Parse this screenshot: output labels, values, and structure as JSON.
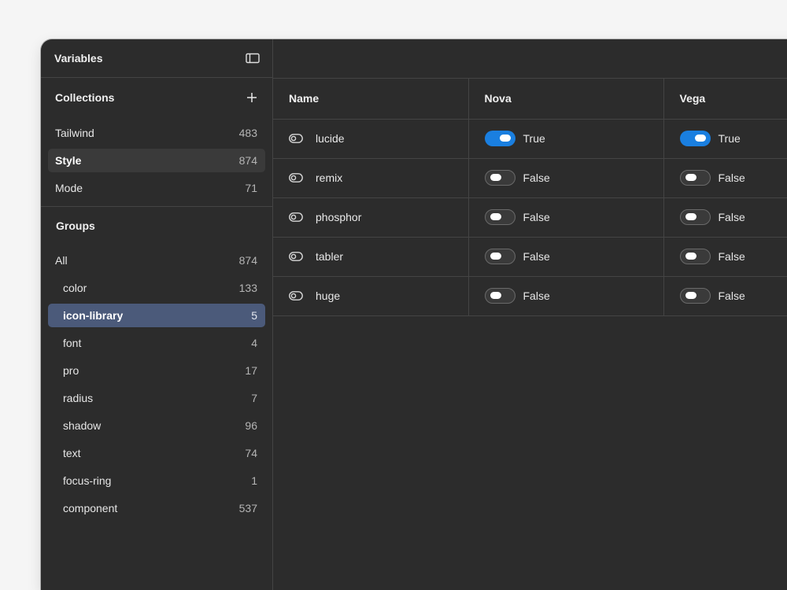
{
  "sidebar": {
    "title": "Variables",
    "collections_label": "Collections",
    "collections": [
      {
        "name": "Tailwind",
        "count": "483"
      },
      {
        "name": "Style",
        "count": "874"
      },
      {
        "name": "Mode",
        "count": "71"
      }
    ],
    "groups_label": "Groups",
    "all_group": {
      "name": "All",
      "count": "874"
    },
    "groups": [
      {
        "name": "color",
        "count": "133"
      },
      {
        "name": "icon-library",
        "count": "5"
      },
      {
        "name": "font",
        "count": "4"
      },
      {
        "name": "pro",
        "count": "17"
      },
      {
        "name": "radius",
        "count": "7"
      },
      {
        "name": "shadow",
        "count": "96"
      },
      {
        "name": "text",
        "count": "74"
      },
      {
        "name": "focus-ring",
        "count": "1"
      },
      {
        "name": "component",
        "count": "537"
      }
    ]
  },
  "table": {
    "headers": [
      "Name",
      "Nova",
      "Vega"
    ],
    "rows": [
      {
        "name": "lucide",
        "nova": "True",
        "vega": "True"
      },
      {
        "name": "remix",
        "nova": "False",
        "vega": "False"
      },
      {
        "name": "phosphor",
        "nova": "False",
        "vega": "False"
      },
      {
        "name": "tabler",
        "nova": "False",
        "vega": "False"
      },
      {
        "name": "huge",
        "nova": "False",
        "vega": "False"
      }
    ]
  },
  "colors": {
    "accent": "#1a7fe0",
    "selected_group": "#4b5a7a",
    "panel_bg": "#2c2c2c"
  },
  "icons": {
    "panel_toggle": "sidebar-panel-icon",
    "add": "plus-icon",
    "variable_type": "boolean-toggle-icon"
  }
}
